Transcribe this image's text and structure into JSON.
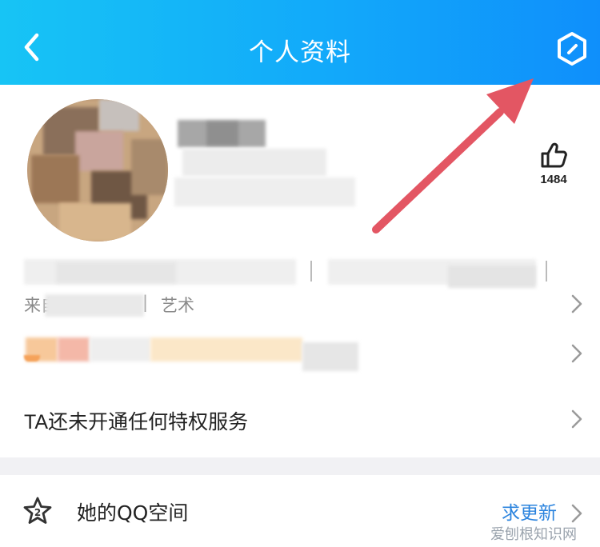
{
  "header": {
    "back_icon": "chevron-left-icon",
    "title": "个人资料",
    "settings_icon": "hexagon-settings-icon"
  },
  "profile": {
    "likes": {
      "icon": "thumbs-up-icon",
      "count": "1484"
    },
    "location_prefix": "来自",
    "info_separator": "|",
    "occupation": "艺术"
  },
  "privilege": {
    "text": "TA还未开通任何特权服务"
  },
  "qzone": {
    "icon": "star-icon",
    "label": "她的QQ空间",
    "action": "求更新"
  },
  "watermark": "爱刨根知识网",
  "annotation": {
    "arrow_color": "#e35663"
  },
  "colors": {
    "header_gradient_start": "#17c4f5",
    "header_gradient_end": "#0f8ffb",
    "link_blue": "#2a83de"
  }
}
